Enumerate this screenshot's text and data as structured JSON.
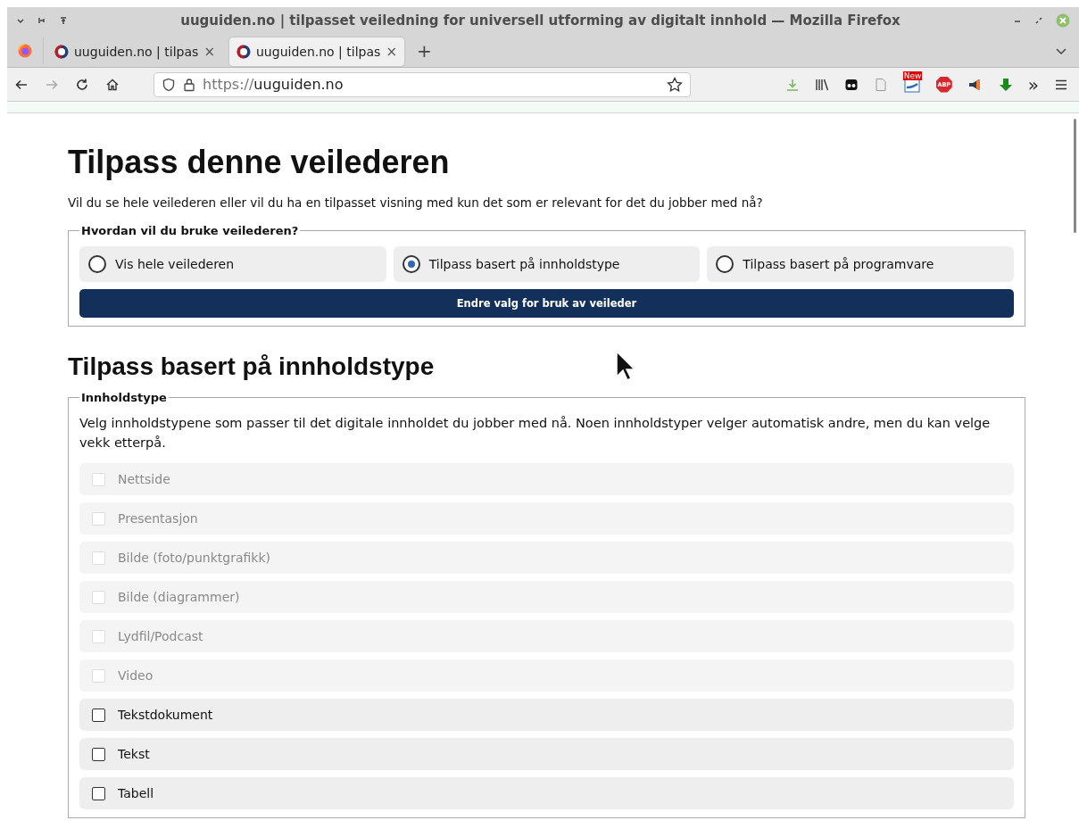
{
  "window": {
    "title": "uuguiden.no | tilpasset veiledning for universell utforming av digitalt innhold — Mozilla Firefox"
  },
  "tabs": [
    {
      "label": "uuguiden.no | tilpas",
      "close": "×",
      "selected": false
    },
    {
      "label": "uuguiden.no | tilpas",
      "close": "×",
      "selected": true
    }
  ],
  "new_tab": "+",
  "address_bar": {
    "scheme": "https://",
    "host": "uuguiden.no"
  },
  "toolbar": {
    "news_badge": "New",
    "adblock_label": "ABP",
    "overflow": "»"
  },
  "page": {
    "heading": "Tilpass denne veilederen",
    "intro": "Vil du se hele veilederen eller vil du ha en tilpasset visning med kun det som er relevant for det du jobber med nå?",
    "usage": {
      "legend": "Hvordan vil du bruke veilederen?",
      "options": [
        {
          "label": "Vis hele veilederen",
          "selected": false
        },
        {
          "label": "Tilpass basert på innholdstype",
          "selected": true
        },
        {
          "label": "Tilpass basert på programvare",
          "selected": false
        }
      ],
      "button": "Endre valg for bruk av veileder"
    },
    "section_heading": "Tilpass basert på innholdstype",
    "content_types": {
      "legend": "Innholdstype",
      "description": "Velg innholdstypene som passer til det digitale innholdet du jobber med nå. Noen innholdstyper velger automatisk andre, men du kan velge vekk etterpå.",
      "items": [
        {
          "label": "Nettside",
          "checked": false,
          "disabled": true
        },
        {
          "label": "Presentasjon",
          "checked": false,
          "disabled": true
        },
        {
          "label": "Bilde (foto/punktgrafikk)",
          "checked": false,
          "disabled": true
        },
        {
          "label": "Bilde (diagrammer)",
          "checked": false,
          "disabled": true
        },
        {
          "label": "Lydfil/Podcast",
          "checked": false,
          "disabled": true
        },
        {
          "label": "Video",
          "checked": false,
          "disabled": true
        },
        {
          "label": "Tekstdokument",
          "checked": false,
          "disabled": false
        },
        {
          "label": "Tekst",
          "checked": false,
          "disabled": false
        },
        {
          "label": "Tabell",
          "checked": false,
          "disabled": false
        }
      ]
    }
  }
}
